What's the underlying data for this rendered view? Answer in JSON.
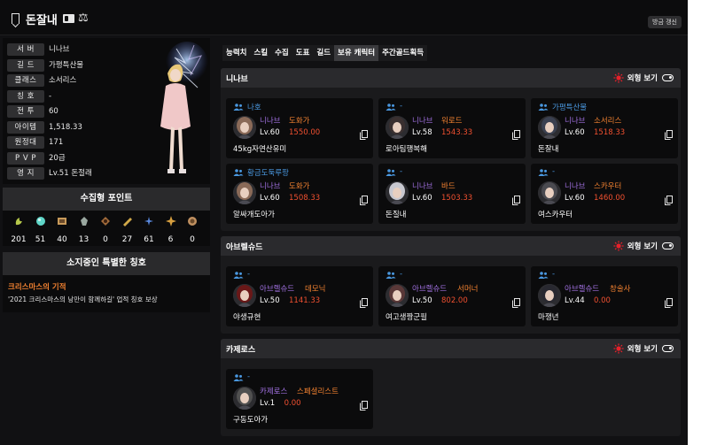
{
  "header": {
    "name": "돈잘내",
    "refresh_label": "방금 갱신"
  },
  "info": [
    {
      "label": "서 버",
      "value": "니나브"
    },
    {
      "label": "길 드",
      "value": "가평특산물"
    },
    {
      "label": "클래스",
      "value": "소서리스"
    },
    {
      "label": "칭 호",
      "value": "-"
    },
    {
      "label": "전 투",
      "value": "60"
    },
    {
      "label": "아이템",
      "value": "1,518.33"
    },
    {
      "label": "원정대",
      "value": "171"
    },
    {
      "label": "P V P",
      "value": "20급"
    },
    {
      "label": "영 지",
      "value": "Lv.51 돈절래"
    }
  ],
  "collectibles": {
    "title": "수집형 포인트",
    "items": [
      {
        "icon": "mokoko-seed-icon",
        "count": "201",
        "color": "#b6c84a"
      },
      {
        "icon": "island-heart-icon",
        "count": "51",
        "color": "#5fd6c8"
      },
      {
        "icon": "great-art-icon",
        "count": "40",
        "color": "#c89a5a"
      },
      {
        "icon": "giant-heart-icon",
        "count": "13",
        "color": "#9aa8a0"
      },
      {
        "icon": "ignea-token-icon",
        "count": "0",
        "color": "#a06a3a"
      },
      {
        "icon": "sea-bounty-icon",
        "count": "27",
        "color": "#d0a848"
      },
      {
        "icon": "world-tree-leaf-icon",
        "count": "61",
        "color": "#5a8ae0"
      },
      {
        "icon": "orpheus-star-icon",
        "count": "6",
        "color": "#d8a040"
      },
      {
        "icon": "omnium-star-icon",
        "count": "0",
        "color": "#c09060"
      }
    ]
  },
  "special_title": {
    "heading": "소지중인 특별한 칭호",
    "name": "크리스마스의 기적",
    "description": "'2021 크리스마스의 낭만이 함께하길' 업적 칭호 보상"
  },
  "tabs": [
    {
      "label": "능력치",
      "active": false
    },
    {
      "label": "스킬",
      "active": false
    },
    {
      "label": "수집",
      "active": false
    },
    {
      "label": "도표",
      "active": false
    },
    {
      "label": "길드",
      "active": false
    },
    {
      "label": "보유 캐릭터",
      "active": true
    },
    {
      "label": "주간골드획득",
      "active": false
    }
  ],
  "look_label": "외형 보기",
  "servers": [
    {
      "name": "니나브",
      "characters": [
        {
          "guild": "나호",
          "server": "니나브",
          "class": "도화가",
          "level": "Lv.60",
          "item_level": "1550.00",
          "name": "45kg자연산유미",
          "hair": "#8a6a58"
        },
        {
          "guild": "-",
          "server": "니나브",
          "class": "워로드",
          "level": "Lv.58",
          "item_level": "1543.33",
          "name": "로아팀행복해",
          "hair": "#3a3030"
        },
        {
          "guild": "가평특산물",
          "server": "니나브",
          "class": "소서리스",
          "level": "Lv.60",
          "item_level": "1518.33",
          "name": "돈잘내",
          "hair": "#3a4050"
        },
        {
          "guild": "황금도둑루팡",
          "server": "니나브",
          "class": "도화가",
          "level": "Lv.60",
          "item_level": "1508.33",
          "name": "알싸개도아가",
          "hair": "#8a6a58"
        },
        {
          "guild": "-",
          "server": "니나브",
          "class": "바드",
          "level": "Lv.60",
          "item_level": "1503.33",
          "name": "돈질내",
          "hair": "#c8c8d0"
        },
        {
          "guild": "-",
          "server": "니나브",
          "class": "스카우터",
          "level": "Lv.60",
          "item_level": "1460.00",
          "name": "여스카우터",
          "hair": "#4a4a50"
        }
      ]
    },
    {
      "name": "아브렐슈드",
      "characters": [
        {
          "guild": "-",
          "server": "아브렐슈드",
          "class": "데모닉",
          "level": "Lv.50",
          "item_level": "1141.33",
          "name": "야생규현",
          "hair": "#6a1818"
        },
        {
          "guild": "-",
          "server": "아브렐슈드",
          "class": "서머너",
          "level": "Lv.50",
          "item_level": "802.00",
          "name": "여고생짱군필",
          "hair": "#5a3838"
        },
        {
          "guild": "-",
          "server": "아브렐슈드",
          "class": "창술사",
          "level": "Lv.44",
          "item_level": "0.00",
          "name": "마쟁년",
          "hair": "#282830"
        }
      ]
    },
    {
      "name": "카제로스",
      "characters": [
        {
          "guild": "-",
          "server": "카제로스",
          "class": "스페셜리스트",
          "level": "Lv.1",
          "item_level": "0.00",
          "name": "구동도아가",
          "hair": "#505050"
        }
      ]
    }
  ],
  "colors": {
    "background": "#111113",
    "panel": "#0b0b0c",
    "guild_blue": "#4a98e0",
    "server_purple": "#a070e0",
    "class_orange": "#f08030",
    "item_level_red": "#f05030",
    "sun_red": "#e8202a"
  }
}
